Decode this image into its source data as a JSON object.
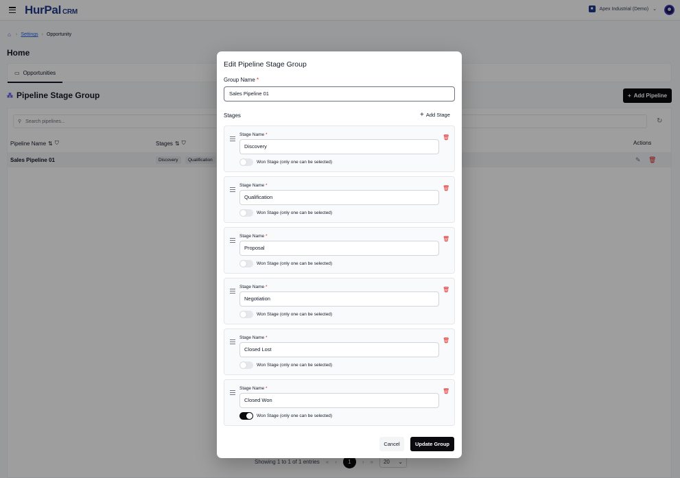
{
  "app": {
    "name": "HurPal",
    "suffix": "CRM",
    "org": "Apex Industrial (Demo)"
  },
  "breadcrumb": {
    "settings": "Settings",
    "current": "Opportunity"
  },
  "page": {
    "title": "Home",
    "tab": "Opportunities",
    "section_title": "Pipeline Stage Group",
    "add_button": "Add Pipeline"
  },
  "table": {
    "search_placeholder": "Search pipelines...",
    "headers": {
      "name": "Pipeline Name",
      "stages": "Stages",
      "actions": "Actions"
    },
    "rows": [
      {
        "name": "Sales Pipeline 01",
        "stages": [
          "Discovery",
          "Qualification"
        ]
      }
    ]
  },
  "pagination": {
    "summary": "Showing 1 to 1 of 1 entries",
    "current": "1",
    "page_size": "20"
  },
  "modal": {
    "title": "Edit Pipeline Stage Group",
    "group_label": "Group Name",
    "required_mark": "*",
    "group_value": "Sales Pipeline 01",
    "stages_label": "Stages",
    "add_stage": "Add Stage",
    "stage_label": "Stage Name",
    "won_label": "Won Stage (only one can be selected)",
    "stages": [
      {
        "name": "Discovery",
        "won": false
      },
      {
        "name": "Qualification",
        "won": false
      },
      {
        "name": "Proposal",
        "won": false
      },
      {
        "name": "Negotiation",
        "won": false
      },
      {
        "name": "Closed Lost",
        "won": false
      },
      {
        "name": "Closed Won",
        "won": true
      }
    ],
    "cancel": "Cancel",
    "update": "Update Group"
  }
}
